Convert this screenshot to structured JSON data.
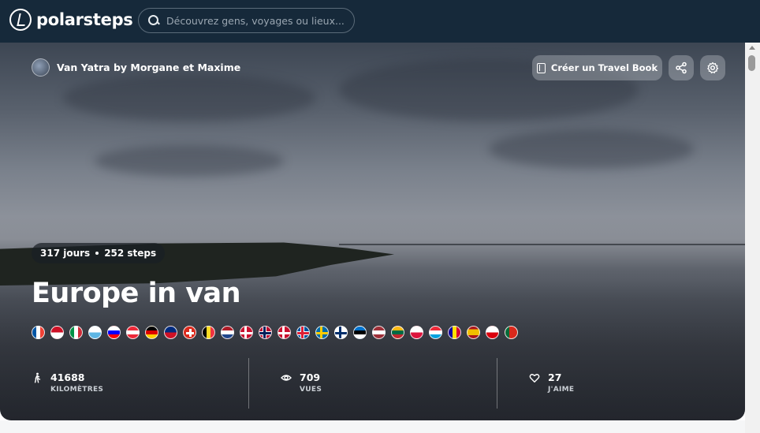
{
  "app": {
    "brand": "polarsteps"
  },
  "search": {
    "placeholder": "Découvrez gens, voyages ou lieux..."
  },
  "trip": {
    "owner": "Van Yatra by Morgane et Maxime",
    "days": "317 jours",
    "steps": "252 steps",
    "title": "Europe in van"
  },
  "actions": {
    "travel_book": "Créer un Travel Book"
  },
  "flags": [
    {
      "name": "france",
      "colors": [
        "#0055a4",
        "#ffffff",
        "#ef4135"
      ],
      "dir": "v"
    },
    {
      "name": "monaco",
      "colors": [
        "#ce1126",
        "#ffffff"
      ],
      "dir": "h"
    },
    {
      "name": "italy",
      "colors": [
        "#009246",
        "#ffffff",
        "#ce2b37"
      ],
      "dir": "v"
    },
    {
      "name": "san-marino",
      "colors": [
        "#ffffff",
        "#5eb6e4"
      ],
      "dir": "h"
    },
    {
      "name": "slovenia",
      "colors": [
        "#ffffff",
        "#0000ff",
        "#ff0000"
      ],
      "dir": "h"
    },
    {
      "name": "austria",
      "colors": [
        "#ed2939",
        "#ffffff",
        "#ed2939"
      ],
      "dir": "h"
    },
    {
      "name": "germany",
      "colors": [
        "#000000",
        "#dd0000",
        "#ffce00"
      ],
      "dir": "h"
    },
    {
      "name": "liechtenstein",
      "colors": [
        "#002b7f",
        "#ce1126"
      ],
      "dir": "h"
    },
    {
      "name": "switzerland",
      "colors": [
        "#da291c"
      ],
      "dir": "h",
      "mark": "cross"
    },
    {
      "name": "belgium",
      "colors": [
        "#000000",
        "#fdda24",
        "#ef3340"
      ],
      "dir": "v"
    },
    {
      "name": "netherlands",
      "colors": [
        "#ae1c28",
        "#ffffff",
        "#21468b"
      ],
      "dir": "h"
    },
    {
      "name": "denmark",
      "colors": [
        "#c8102e"
      ],
      "dir": "h",
      "mark": "nordic-white"
    },
    {
      "name": "norway",
      "colors": [
        "#ba0c2f"
      ],
      "dir": "h",
      "mark": "nordic-blue"
    },
    {
      "name": "denmark-2",
      "colors": [
        "#c8102e"
      ],
      "dir": "h",
      "mark": "nordic-white"
    },
    {
      "name": "iceland",
      "colors": [
        "#02529c"
      ],
      "dir": "h",
      "mark": "nordic-red"
    },
    {
      "name": "sweden",
      "colors": [
        "#006aa7"
      ],
      "dir": "h",
      "mark": "nordic-yellow"
    },
    {
      "name": "finland",
      "colors": [
        "#ffffff"
      ],
      "dir": "h",
      "mark": "nordic-darkblue"
    },
    {
      "name": "estonia",
      "colors": [
        "#0072ce",
        "#000000",
        "#ffffff"
      ],
      "dir": "h"
    },
    {
      "name": "latvia",
      "colors": [
        "#9e3039",
        "#ffffff",
        "#9e3039"
      ],
      "dir": "h"
    },
    {
      "name": "lithuania",
      "colors": [
        "#fdb913",
        "#006a44",
        "#c1272d"
      ],
      "dir": "h"
    },
    {
      "name": "poland",
      "colors": [
        "#ffffff",
        "#dc143c"
      ],
      "dir": "h"
    },
    {
      "name": "luxembourg",
      "colors": [
        "#ed2939",
        "#ffffff",
        "#00a1de"
      ],
      "dir": "h"
    },
    {
      "name": "andorra",
      "colors": [
        "#10069f",
        "#fedf00",
        "#d50032"
      ],
      "dir": "v"
    },
    {
      "name": "spain",
      "colors": [
        "#aa151b",
        "#f1bf00",
        "#f1bf00",
        "#aa151b"
      ],
      "dir": "h"
    },
    {
      "name": "gibraltar",
      "colors": [
        "#ffffff",
        "#da000c"
      ],
      "dir": "h"
    },
    {
      "name": "portugal",
      "colors": [
        "#046a38",
        "#da291c",
        "#da291c"
      ],
      "dir": "v"
    }
  ],
  "stats": [
    {
      "icon": "walking-icon",
      "value": "41688",
      "label": "KILOMÈTRES"
    },
    {
      "icon": "eye-icon",
      "value": "709",
      "label": "VUES"
    },
    {
      "icon": "heart-icon",
      "value": "27",
      "label": "J'AIME"
    }
  ]
}
